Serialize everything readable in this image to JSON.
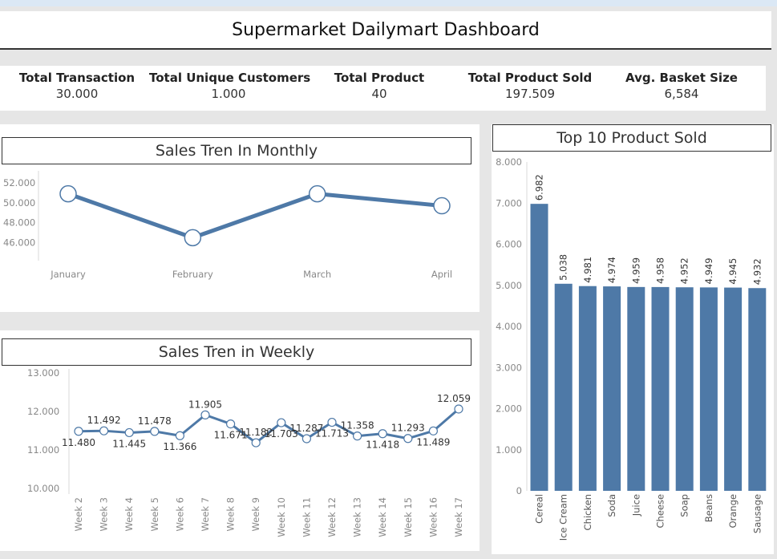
{
  "header": {
    "title": "Supermarket Dailymart Dashboard"
  },
  "colors": {
    "accent": "#4e79a7"
  },
  "kpis": [
    {
      "label": "Total Transaction",
      "value": "30.000"
    },
    {
      "label": "Total Unique Customers",
      "value": "1.000"
    },
    {
      "label": "Total Product",
      "value": "40"
    },
    {
      "label": "Total Product Sold",
      "value": "197.509"
    },
    {
      "label": "Avg. Basket Size",
      "value": "6,584"
    }
  ],
  "chart_data": [
    {
      "id": "monthly",
      "type": "line",
      "title": "Sales Tren In Monthly",
      "categories": [
        "January",
        "February",
        "March",
        "April"
      ],
      "values": [
        50900,
        46500,
        50900,
        49700
      ],
      "yticks": [
        "46.000",
        "48.000",
        "50.000",
        "52.000"
      ],
      "ytick_values": [
        46000,
        48000,
        50000,
        52000
      ],
      "ylim": [
        44200,
        53200
      ]
    },
    {
      "id": "weekly",
      "type": "line",
      "title": "Sales Tren in Weekly",
      "categories": [
        "Week 2",
        "Week 3",
        "Week 4",
        "Week 5",
        "Week 6",
        "Week 7",
        "Week 8",
        "Week 9",
        "Week 10",
        "Week 11",
        "Week 12",
        "Week 13",
        "Week 14",
        "Week 15",
        "Week 16",
        "Week 17"
      ],
      "values": [
        11480,
        11492,
        11445,
        11478,
        11366,
        11905,
        11671,
        11182,
        11703,
        11287,
        11713,
        11358,
        11418,
        11293,
        11489,
        12059
      ],
      "labels": [
        "11.480",
        "11.492",
        "11.445",
        "11.478",
        "11.366",
        "11.905",
        "11.671",
        "11.182",
        "11.703",
        "11.287",
        "11.713",
        "11.358",
        "11.418",
        "11.293",
        "11.489",
        "12.059"
      ],
      "yticks": [
        "10.000",
        "11.000",
        "12.000",
        "13.000"
      ],
      "ytick_values": [
        10000,
        11000,
        12000,
        13000
      ],
      "ylim": [
        9850,
        13100
      ]
    },
    {
      "id": "top10",
      "type": "bar",
      "title": "Top 10 Product Sold",
      "categories": [
        "Cereal",
        "Ice Cream",
        "Chicken",
        "Soda",
        "Juice",
        "Cheese",
        "Soap",
        "Beans",
        "Orange",
        "Sausage"
      ],
      "values": [
        6982,
        5038,
        4981,
        4974,
        4959,
        4958,
        4952,
        4949,
        4945,
        4932
      ],
      "labels": [
        "6.982",
        "5.038",
        "4.981",
        "4.974",
        "4.959",
        "4.958",
        "4.952",
        "4.949",
        "4.945",
        "4.932"
      ],
      "yticks": [
        "0",
        "1.000",
        "2.000",
        "3.000",
        "4.000",
        "5.000",
        "6.000",
        "7.000",
        "8.000"
      ],
      "ytick_values": [
        0,
        1000,
        2000,
        3000,
        4000,
        5000,
        6000,
        7000,
        8000
      ],
      "ylim": [
        0,
        8000
      ]
    }
  ]
}
